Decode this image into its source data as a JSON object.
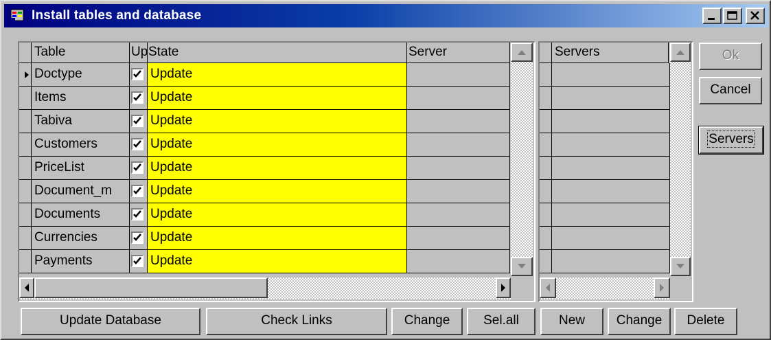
{
  "window": {
    "title": "Install tables and database",
    "controls": [
      "minimize",
      "maximize",
      "close"
    ]
  },
  "tables_grid": {
    "columns": [
      "Table",
      "Up",
      "State",
      "Server"
    ],
    "current_row_index": 0,
    "rows": [
      {
        "table": "Doctype",
        "update": true,
        "state": "Update",
        "server": ""
      },
      {
        "table": "Items",
        "update": true,
        "state": "Update",
        "server": ""
      },
      {
        "table": "Tabiva",
        "update": true,
        "state": "Update",
        "server": ""
      },
      {
        "table": "Customers",
        "update": true,
        "state": "Update",
        "server": ""
      },
      {
        "table": "PriceList",
        "update": true,
        "state": "Update",
        "server": ""
      },
      {
        "table": "Document_m",
        "update": true,
        "state": "Update",
        "server": ""
      },
      {
        "table": "Documents",
        "update": true,
        "state": "Update",
        "server": ""
      },
      {
        "table": "Currencies",
        "update": true,
        "state": "Update",
        "server": ""
      },
      {
        "table": "Payments",
        "update": true,
        "state": "Update",
        "server": ""
      }
    ],
    "state_color": "#ffff00"
  },
  "servers_grid": {
    "columns": [
      "Servers"
    ],
    "rows": [
      "",
      "",
      "",
      "",
      "",
      "",
      "",
      "",
      ""
    ]
  },
  "side_buttons": {
    "ok": "Ok",
    "cancel": "Cancel",
    "servers": "Servers"
  },
  "bottom_buttons": {
    "update_database": "Update Database",
    "check_links": "Check Links",
    "change": "Change",
    "select_all": "Sel.all",
    "new": "New",
    "change2": "Change",
    "delete": "Delete"
  }
}
